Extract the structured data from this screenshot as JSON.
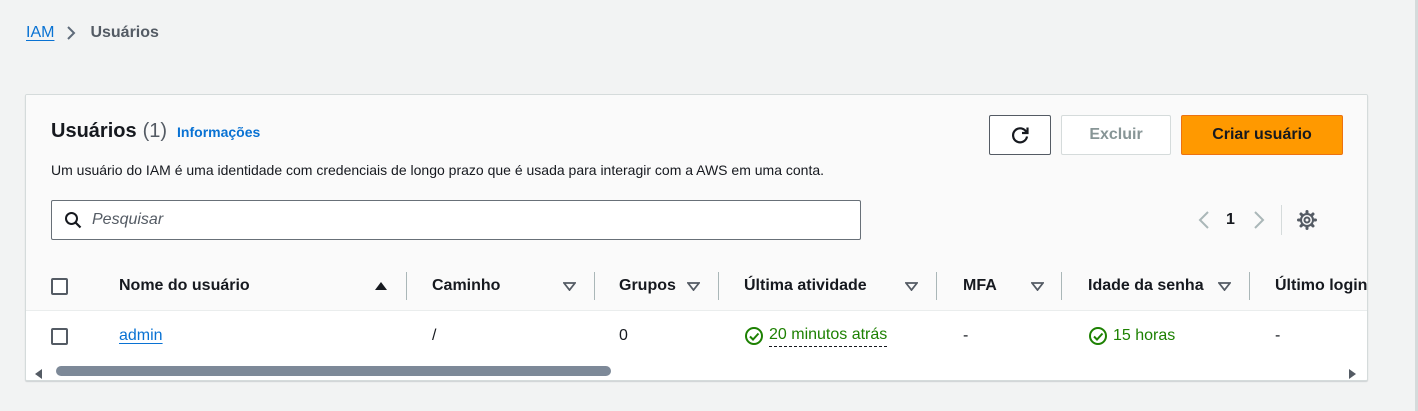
{
  "breadcrumb": {
    "root": "IAM",
    "current": "Usuários"
  },
  "panel": {
    "title": "Usuários",
    "count": "(1)",
    "info_link": "Informações",
    "description": "Um usuário do IAM é uma identidade com credenciais de longo prazo que é usada para interagir com a AWS em uma conta."
  },
  "actions": {
    "refresh_icon": "refresh-icon",
    "delete_label": "Excluir",
    "create_label": "Criar usuário"
  },
  "search": {
    "placeholder": "Pesquisar",
    "value": "",
    "icon": "search-icon"
  },
  "pagination": {
    "current_page": "1"
  },
  "table": {
    "columns": [
      "Nome do usuário",
      "Caminho",
      "Grupos",
      "Última atividade",
      "MFA",
      "Idade da senha",
      "Último login"
    ],
    "sort": {
      "column": "Nome do usuário",
      "direction": "ascending"
    },
    "rows": [
      {
        "name": "admin",
        "path": "/",
        "groups": "0",
        "last_activity": "20 minutos atrás",
        "mfa": "-",
        "password_age": "15 horas",
        "last_login": "-"
      }
    ]
  },
  "colors": {
    "accent_link": "#0972d3",
    "primary_button": "#ff9900",
    "success": "#1d8102",
    "background": "#f2f3f3"
  }
}
